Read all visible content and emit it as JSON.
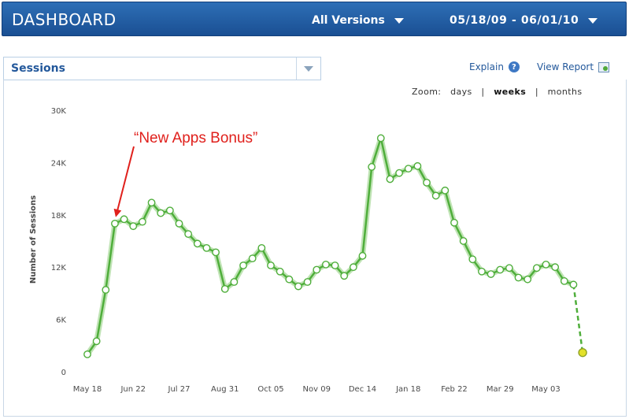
{
  "header": {
    "title": "DASHBOARD",
    "versions_label": "All Versions",
    "date_range": "05/18/09 - 06/01/10"
  },
  "metric_selector": {
    "value": "Sessions"
  },
  "links": {
    "explain": "Explain",
    "view_report": "View Report"
  },
  "zoom": {
    "label": "Zoom:",
    "options": [
      "days",
      "weeks",
      "months"
    ],
    "selected": "weeks"
  },
  "icons": {
    "help": "help-circle-icon",
    "report": "report-icon",
    "dropdown": "chevron-down-icon"
  },
  "colors": {
    "header_blue": "#2264ad",
    "series_green": "#4fae3b",
    "annotation_red": "#e0201c",
    "last_point_yellow": "#e3e12a"
  },
  "chart_data": {
    "type": "line",
    "title": "",
    "ylabel": "Number of Sessions",
    "xlabel": "",
    "ylim": [
      0,
      30000
    ],
    "y_ticks": [
      {
        "value": 0,
        "label": "0"
      },
      {
        "value": 6000,
        "label": "6K"
      },
      {
        "value": 12000,
        "label": "12K"
      },
      {
        "value": 18000,
        "label": "18K"
      },
      {
        "value": 24000,
        "label": "24K"
      },
      {
        "value": 30000,
        "label": "30K"
      }
    ],
    "x_ticks": [
      {
        "index": 0,
        "label": "May 18"
      },
      {
        "index": 5,
        "label": "Jun 22"
      },
      {
        "index": 10,
        "label": "Jul 27"
      },
      {
        "index": 15,
        "label": "Aug 31"
      },
      {
        "index": 20,
        "label": "Oct 05"
      },
      {
        "index": 25,
        "label": "Nov 09"
      },
      {
        "index": 30,
        "label": "Dec 14"
      },
      {
        "index": 35,
        "label": "Jan 18"
      },
      {
        "index": 40,
        "label": "Feb 22"
      },
      {
        "index": 45,
        "label": "Mar 29"
      },
      {
        "index": 50,
        "label": "May 03"
      }
    ],
    "grid": false,
    "legend": "none",
    "series": [
      {
        "values": [
          2000,
          3500,
          9400,
          17000,
          17500,
          16700,
          17200,
          19400,
          18200,
          18500,
          17000,
          15800,
          14700,
          14200,
          13700,
          9500,
          10300,
          12200,
          13000,
          14200,
          12200,
          11500,
          10600,
          9800,
          10300,
          11700,
          12300,
          12200,
          11000,
          12000,
          13300,
          23500,
          26800,
          22100,
          22800,
          23300,
          23600,
          21700,
          20200,
          20800,
          17100,
          15000,
          12900,
          11500,
          11200,
          11700,
          11900,
          10800,
          10600,
          11900,
          12300,
          12000,
          10400,
          10000,
          2200
        ],
        "last_point_partial": true
      }
    ],
    "annotations": [
      {
        "text": "“New Apps Bonus”",
        "point_index": 3
      }
    ]
  }
}
